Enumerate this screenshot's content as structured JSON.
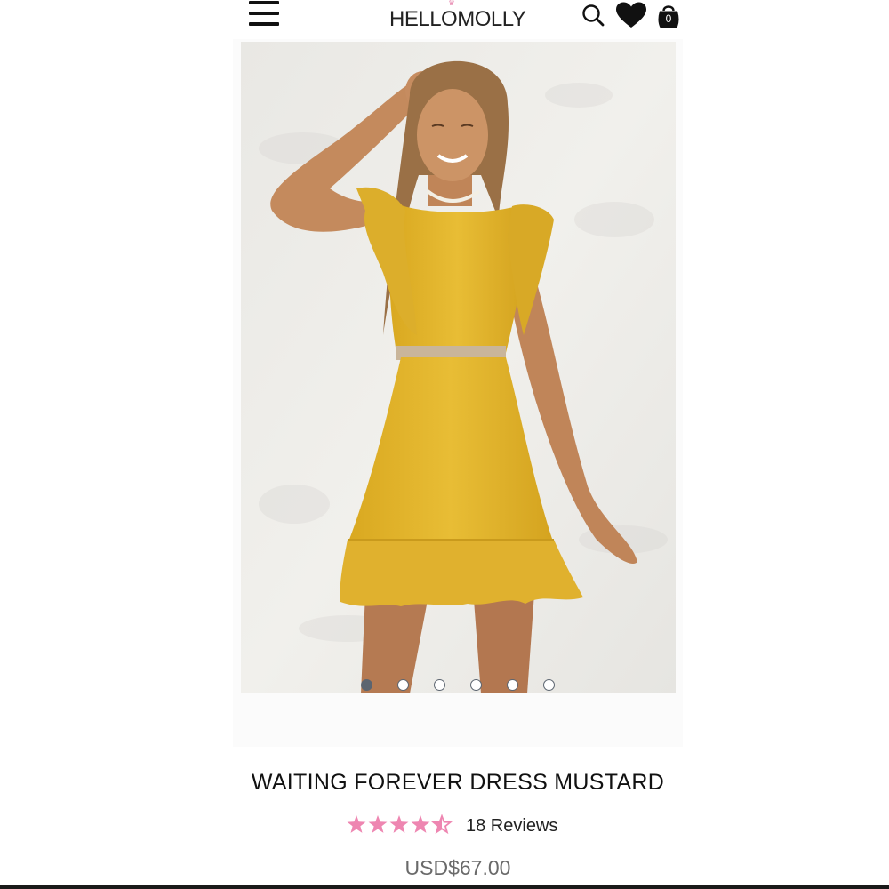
{
  "header": {
    "logo": "HELLOMOLLY",
    "cart_count": "0"
  },
  "icons": {
    "menu": "hamburger-menu-icon",
    "search": "search-icon",
    "wishlist": "heart-icon",
    "cart": "shopping-bag-icon"
  },
  "gallery": {
    "image_count": 6,
    "active_index": 0
  },
  "product": {
    "title": "WAITING FOREVER DRESS MUSTARD",
    "rating": 4.5,
    "rating_max": 5,
    "reviews_label": "18 Reviews",
    "price": "USD$67.00"
  },
  "colors": {
    "star": "#ee86b1",
    "dress": "#e2b52c",
    "dot_active": "#5c6570"
  }
}
